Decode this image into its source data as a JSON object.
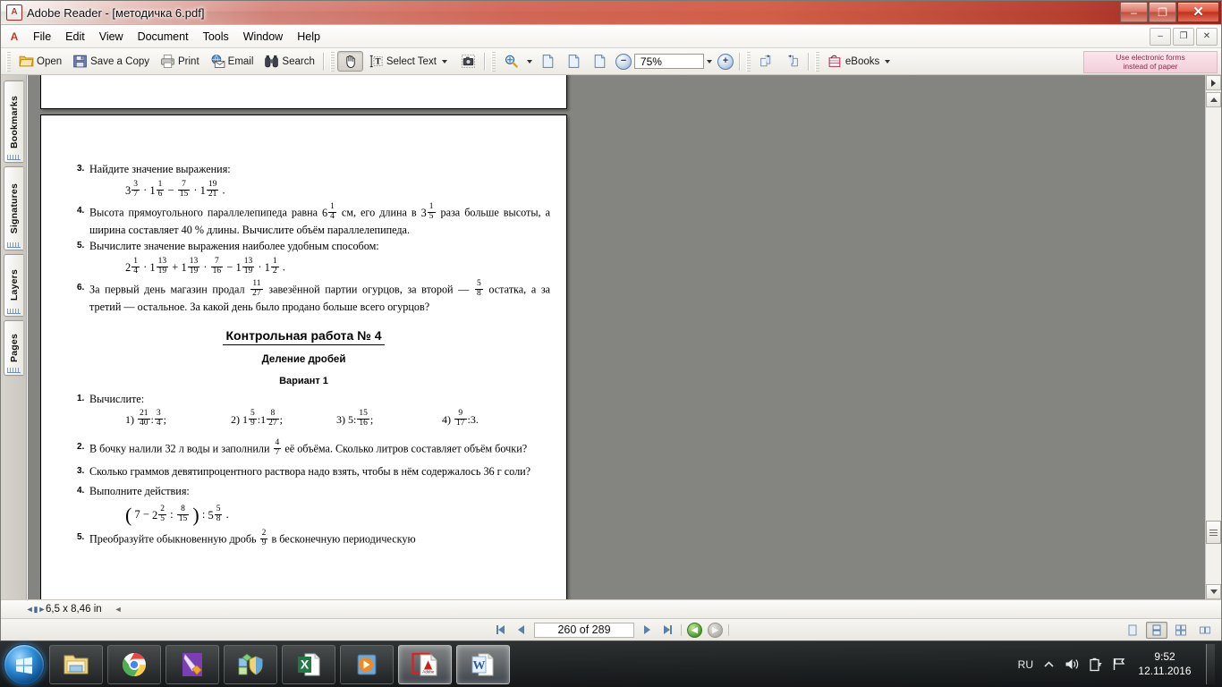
{
  "window": {
    "title": "Adobe Reader - [методичка 6.pdf]",
    "app_icon": "adobe-reader-icon",
    "minimize": "–",
    "maximize": "❐",
    "close": "✕",
    "mdi_minimize": "–",
    "mdi_restore": "❐",
    "mdi_close": "✕"
  },
  "menubar": {
    "items": [
      {
        "label": "File"
      },
      {
        "label": "Edit"
      },
      {
        "label": "View"
      },
      {
        "label": "Document"
      },
      {
        "label": "Tools"
      },
      {
        "label": "Window"
      },
      {
        "label": "Help"
      }
    ]
  },
  "toolbar": {
    "open_label": "Open",
    "save_label": "Save a Copy",
    "print_label": "Print",
    "email_label": "Email",
    "search_label": "Search",
    "select_text_label": "Select Text",
    "zoom_value": "75%",
    "zoom_out": "−",
    "zoom_in": "+",
    "ebooks_label": "eBooks",
    "ad_line1": "Use electronic forms",
    "ad_line2": "instead of paper"
  },
  "navpane": {
    "tabs": [
      {
        "label": "Bookmarks"
      },
      {
        "label": "Signatures"
      },
      {
        "label": "Layers"
      },
      {
        "label": "Pages"
      }
    ]
  },
  "document": {
    "problems_top": [
      {
        "num": "3.",
        "text": "Найдите значение выражения:",
        "equation": true
      },
      {
        "num": "4.",
        "text_a": "Высота прямоугольного параллелепипеда равна",
        "frac_a_whole": "6",
        "frac_a_num": "1",
        "frac_a_den": "4",
        "text_b": "см, его длина в",
        "frac_b_whole": "3",
        "frac_b_num": "1",
        "frac_b_den": "5",
        "text_c": "раза больше высоты, а ширина составляет 40 % длины. Вычислите объём параллелепипеда."
      },
      {
        "num": "5.",
        "text": "Вычислите значение выражения наиболее удобным способом:",
        "equation": true
      },
      {
        "num": "6.",
        "text_a": "За первый день магазин продал",
        "frac_a_num": "11",
        "frac_a_den": "27",
        "text_b": "завезённой партии огурцов, за второй —",
        "frac_b_num": "5",
        "frac_b_den": "8",
        "text_c": "остатка, а за третий — остальное. За какой день было продано больше всего огурцов?"
      }
    ],
    "headings": {
      "title": "Контрольная работа № 4",
      "subtitle": "Деление дробей",
      "variant": "Вариант 1"
    },
    "problems_bottom": [
      {
        "num": "1.",
        "text": "Вычислите:"
      },
      {
        "num": "2.",
        "text_a": "В бочку налили 32 л воды и заполнили",
        "frac_num": "4",
        "frac_den": "7",
        "text_b": "её объёма. Сколько литров составляет объём бочки?"
      },
      {
        "num": "3.",
        "text": "Сколько граммов девятипроцентного раствора надо взять, чтобы в нём содержалось 36 г соли?"
      },
      {
        "num": "4.",
        "text": "Выполните действия:"
      },
      {
        "num": "5.",
        "text_a": "Преобразуйте обыкновенную дробь",
        "frac_num": "2",
        "frac_den": "9",
        "text_b": "в бесконечную периодическую"
      }
    ],
    "eq3": {
      "a_whole": "3",
      "a_num": "3",
      "a_den": "7",
      "b_whole": "1",
      "b_num": "1",
      "b_den": "6",
      "c_num": "7",
      "c_den": "15",
      "d_whole": "1",
      "d_num": "19",
      "d_den": "21",
      "op1": "·",
      "op2": "−",
      "op3": "·",
      "end": "."
    },
    "eq5": {
      "a_whole": "2",
      "a_num": "1",
      "a_den": "4",
      "b_whole": "1",
      "b_num": "13",
      "b_den": "19",
      "c_whole": "1",
      "c_num": "13",
      "c_den": "19",
      "d_num": "7",
      "d_den": "16",
      "e_whole": "1",
      "e_num": "13",
      "e_den": "19",
      "f_whole": "1",
      "f_num": "1",
      "f_den": "2",
      "op1": "·",
      "op2": "+",
      "op3": "·",
      "op4": "−",
      "op5": "·",
      "end": "."
    },
    "eq_list1": [
      {
        "label": "1)",
        "a_num": "21",
        "a_den": "40",
        "sep": ":",
        "b_num": "3",
        "b_den": "4",
        "end": ";"
      },
      {
        "label": "2)",
        "a_whole": "1",
        "a_num": "5",
        "a_den": "9",
        "sep": ":",
        "b_whole": "1",
        "b_num": "8",
        "b_den": "27",
        "end": ";"
      },
      {
        "label": "3)",
        "a_int": "5",
        "sep": ":",
        "b_num": "15",
        "b_den": "16",
        "end": ";"
      },
      {
        "label": "4)",
        "a_num": "9",
        "a_den": "17",
        "sep": ":",
        "b_int": "3",
        "end": "."
      }
    ],
    "eq4": {
      "open": "(",
      "int": "7",
      "minus": "−",
      "a_whole": "2",
      "a_num": "2",
      "a_den": "5",
      "sep1": ":",
      "b_num": "8",
      "b_den": "15",
      "close": ")",
      "sep2": ":",
      "c_whole": "5",
      "c_num": "5",
      "c_den": "8",
      "end": "."
    }
  },
  "statusbar": {
    "page_size": "6,5 x 8,46 in"
  },
  "navbar": {
    "page_indicator": "260 of 289",
    "first_page_icon": "first-page-icon",
    "prev_page_icon": "previous-page-icon",
    "next_page_icon": "next-page-icon",
    "last_page_icon": "last-page-icon",
    "back_icon": "go-back-icon",
    "forward_icon": "go-forward-icon",
    "view_single": "single-page-view",
    "view_continuous": "continuous-view",
    "view_facing": "facing-view",
    "view_continuous_facing": "continuous-facing-view"
  },
  "taskbar": {
    "start": "start-orb",
    "items": [
      {
        "name": "explorer",
        "icon": "folder-icon"
      },
      {
        "name": "chrome",
        "icon": "chrome-icon"
      },
      {
        "name": "paint-app",
        "icon": "brush-icon"
      },
      {
        "name": "security-app",
        "icon": "shield-icon"
      },
      {
        "name": "excel",
        "icon": "excel-icon"
      },
      {
        "name": "media-player",
        "icon": "play-icon"
      },
      {
        "name": "adobe-reader",
        "icon": "adobe-icon",
        "active": true
      },
      {
        "name": "word",
        "icon": "word-icon",
        "active": true
      }
    ],
    "tray": {
      "language": "RU",
      "show_hidden": "show-hidden-icons",
      "volume": "volume-icon",
      "battery": "battery-icon",
      "action_center": "flag-icon"
    },
    "clock": {
      "time": "9:52",
      "date": "12.11.2016"
    }
  }
}
